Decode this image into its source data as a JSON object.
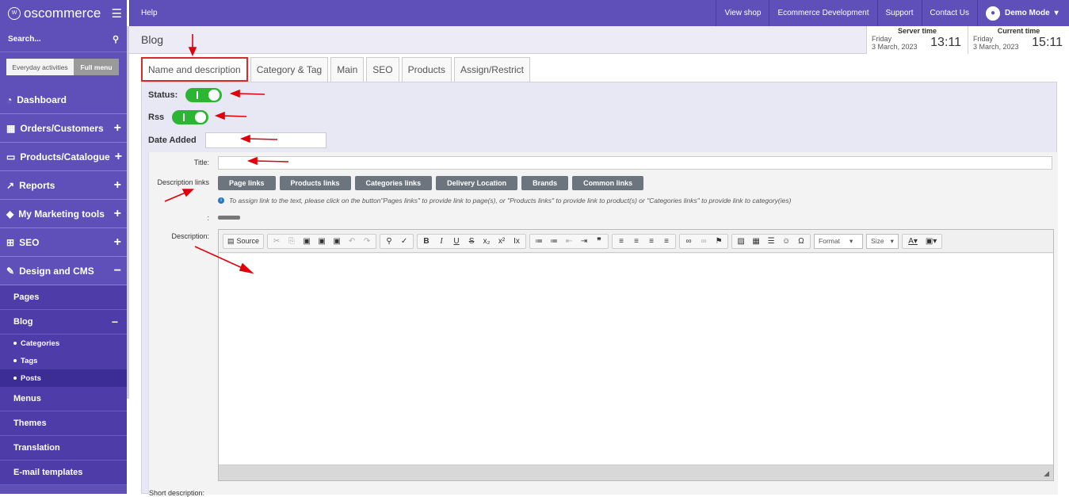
{
  "brand": {
    "name": "oscommerce",
    "logo_text": "W"
  },
  "sidebar": {
    "search_label": "Search...",
    "modes": [
      "Everyday activities",
      "Full menu"
    ],
    "items": [
      {
        "label": "Dashboard",
        "icon": "speedometer-icon",
        "expand": ""
      },
      {
        "label": "Orders/Customers",
        "icon": "cubes-icon",
        "expand": "+"
      },
      {
        "label": "Products/Catalogue",
        "icon": "folder-icon",
        "expand": "+"
      },
      {
        "label": "Reports",
        "icon": "chart-icon",
        "expand": "+"
      },
      {
        "label": "My Marketing tools",
        "icon": "tag-icon",
        "expand": "+"
      },
      {
        "label": "SEO",
        "icon": "sitemap-icon",
        "expand": "+"
      },
      {
        "label": "Design and CMS",
        "icon": "pencil-icon",
        "expand": "−"
      }
    ],
    "design_sub": [
      {
        "label": "Pages"
      },
      {
        "label": "Blog",
        "expand": "−"
      }
    ],
    "blog_sub": [
      "Categories",
      "Tags",
      "Posts"
    ],
    "after_sub": [
      "Menus",
      "Themes",
      "Translation",
      "E-mail templates"
    ]
  },
  "topbar": {
    "help": "Help",
    "links": [
      "View shop",
      "Ecommerce Development",
      "Support",
      "Contact Us"
    ],
    "user": "Demo Mode"
  },
  "header": {
    "title": "Blog",
    "server_time": {
      "label": "Server time",
      "day": "Friday",
      "date": "3 March, 2023",
      "time": "13:11"
    },
    "current_time": {
      "label": "Current time",
      "day": "Friday",
      "date": "3 March, 2023",
      "time": "15:11"
    }
  },
  "tabs": [
    "Name and description",
    "Category & Tag",
    "Main",
    "SEO",
    "Products",
    "Assign/Restrict"
  ],
  "form": {
    "status_label": "Status:",
    "rss_label": "Rss",
    "date_added_label": "Date Added",
    "date_added_value": "",
    "title_label": "Title:",
    "title_value": "",
    "desc_links_label": "Description links",
    "desc_links": [
      "Page links",
      "Products links",
      "Categories links",
      "Delivery Location",
      "Brands",
      "Common links"
    ],
    "info_text": "To assign link to the text, please click on the button\"Pages links\" to provide link to page(s), or \"Products links\" to provide link to product(s) or \"Categories links\" to provide link to category(ies)",
    "colon_label": ":",
    "description_label": "Description:",
    "short_description_label": "Short description:",
    "source_label": "Source",
    "format_label": "Format",
    "size_label": "Size"
  },
  "colors": {
    "brand": "#5f4fb8",
    "toggle_on": "#2bb532",
    "annotation": "#e0000a"
  }
}
